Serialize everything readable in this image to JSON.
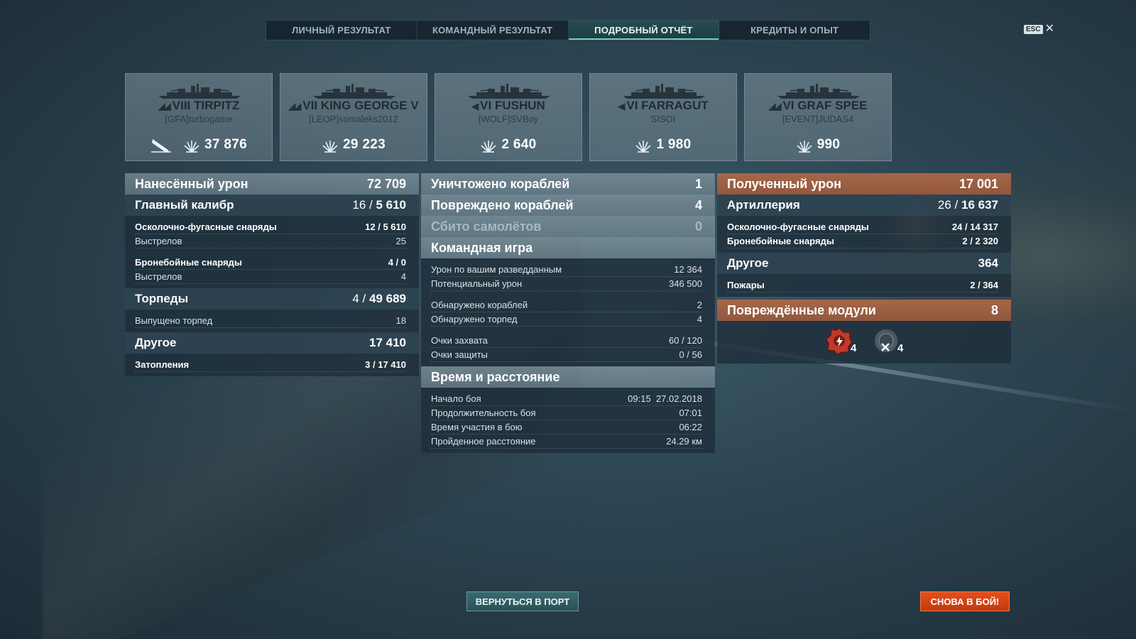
{
  "tabs": [
    "ЛИЧНЫЙ РЕЗУЛЬТАТ",
    "КОМАНДНЫЙ РЕЗУЛЬТАТ",
    "ПОДРОБНЫЙ ОТЧЁТ",
    "КРЕДИТЫ И ОПЫТ"
  ],
  "active_tab": "ПОДРОБНЫЙ ОТЧЁТ",
  "esc": {
    "key": "ESC",
    "close": "✕"
  },
  "ships": [
    {
      "tier": "VIII",
      "name": "TIRPITZ",
      "player": "[GFA]turbogame",
      "damage": "37 876",
      "sunk": true,
      "class_icon": "battleship-icon"
    },
    {
      "tier": "VII",
      "name": "KING GEORGE V",
      "player": "[LEOP]somaleks2012",
      "damage": "29 223",
      "sunk": false,
      "class_icon": "battleship-icon"
    },
    {
      "tier": "VI",
      "name": "FUSHUN",
      "player": "[WOLF]SVBoy",
      "damage": "2 640",
      "sunk": false,
      "class_icon": "destroyer-icon"
    },
    {
      "tier": "VI",
      "name": "FARRAGUT",
      "player": "SISOI",
      "damage": "1 980",
      "sunk": false,
      "class_icon": "destroyer-icon"
    },
    {
      "tier": "VI",
      "name": "GRAF SPEE",
      "player": "[EVENT]JUDAS4",
      "damage": "990",
      "sunk": false,
      "class_icon": "battleship-icon"
    }
  ],
  "left": {
    "header": {
      "label": "Нанесённый урон",
      "value": "72 709"
    },
    "main_battery": {
      "label": "Главный калибр",
      "hits": "16",
      "sep": "/",
      "damage": "5 610"
    },
    "he_shells": {
      "label": "Осколочно-фугасные снаряды",
      "hits": "12",
      "damage": "5 610"
    },
    "he_shots": {
      "label": "Выстрелов",
      "value": "25"
    },
    "ap_shells": {
      "label": "Бронебойные снаряды",
      "hits": "4",
      "damage": "0"
    },
    "ap_shots": {
      "label": "Выстрелов",
      "value": "4"
    },
    "torpedoes": {
      "label": "Торпеды",
      "hits": "4",
      "damage": "49 689"
    },
    "torp_launched": {
      "label": "Выпущено торпед",
      "value": "18"
    },
    "other": {
      "label": "Другое",
      "value": "17 410"
    },
    "flooding": {
      "label": "Затопления",
      "hits": "3",
      "damage": "17 410"
    }
  },
  "mid": {
    "destroyed": {
      "label": "Уничтожено кораблей",
      "value": "1"
    },
    "damaged": {
      "label": "Повреждено кораблей",
      "value": "4"
    },
    "planes": {
      "label": "Сбито самолётов",
      "value": "0"
    },
    "team": {
      "label": "Командная игра"
    },
    "spotting_dmg": {
      "label": "Урон по вашим разведданным",
      "value": "12 364"
    },
    "potential_dmg": {
      "label": "Потенциальный урон",
      "value": "346 500"
    },
    "ships_spotted": {
      "label": "Обнаружено кораблей",
      "value": "2"
    },
    "torps_spotted": {
      "label": "Обнаружено торпед",
      "value": "4"
    },
    "capture": {
      "label": "Очки захвата",
      "value": "60 / 120"
    },
    "defense": {
      "label": "Очки защиты",
      "value": "0 / 56"
    },
    "time": {
      "label": "Время и расстояние"
    },
    "battle_start": {
      "label": "Начало боя",
      "value": "09:15  27.02.2018"
    },
    "battle_duration": {
      "label": "Продолжительность боя",
      "value": "07:01"
    },
    "participation": {
      "label": "Время участия в бою",
      "value": "06:22"
    },
    "distance": {
      "label": "Пройденное расстояние",
      "value": "24.29 км"
    }
  },
  "right": {
    "header": {
      "label": "Полученный урон",
      "value": "17 001"
    },
    "artillery": {
      "label": "Артиллерия",
      "hits": "26",
      "damage": "16 637"
    },
    "he_shells": {
      "label": "Осколочно-фугасные снаряды",
      "hits": "24",
      "damage": "14 317"
    },
    "ap_shells": {
      "label": "Бронебойные снаряды",
      "hits": "2",
      "damage": "2 320"
    },
    "other": {
      "label": "Другое",
      "value": "364"
    },
    "fires": {
      "label": "Пожары",
      "hits": "2",
      "damage": "364"
    },
    "modules": {
      "label": "Повреждённые модули",
      "value": "8"
    },
    "module_items": [
      {
        "icon": "module-damaged-icon",
        "count": "4"
      },
      {
        "icon": "module-destroyed-icon",
        "count": "4"
      }
    ]
  },
  "buttons": {
    "port": "ВЕРНУТЬСЯ В ПОРТ",
    "battle": "СНОВА В БОЙ!"
  },
  "colors": {
    "accent_teal": "#6fd0c8",
    "received_orange": "#ac6848",
    "battle_button": "#e3501e",
    "port_button": "#3b6a72"
  }
}
